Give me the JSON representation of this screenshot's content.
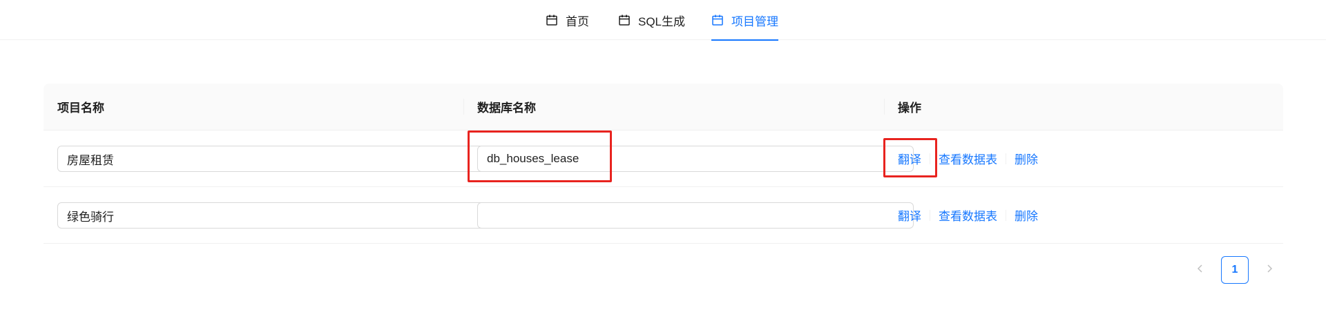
{
  "nav": {
    "items": [
      {
        "label": "首页",
        "icon": "calendar-icon",
        "active": false
      },
      {
        "label": "SQL生成",
        "icon": "calendar-icon",
        "active": false
      },
      {
        "label": "项目管理",
        "icon": "calendar-icon",
        "active": true
      }
    ]
  },
  "table": {
    "columns": [
      "项目名称",
      "数据库名称",
      "操作"
    ],
    "rows": [
      {
        "project_name": "房屋租赁",
        "db_name": "db_houses_lease",
        "actions": [
          "翻译",
          "查看数据表",
          "删除"
        ]
      },
      {
        "project_name": "绿色骑行",
        "db_name": "",
        "actions": [
          "翻译",
          "查看数据表",
          "删除"
        ]
      }
    ]
  },
  "pagination": {
    "current": "1",
    "prev_icon": "chevron-left-icon",
    "next_icon": "chevron-right-icon"
  },
  "colors": {
    "accent": "#1677ff",
    "highlight": "#e8231f",
    "header_bg": "#fafafa"
  }
}
